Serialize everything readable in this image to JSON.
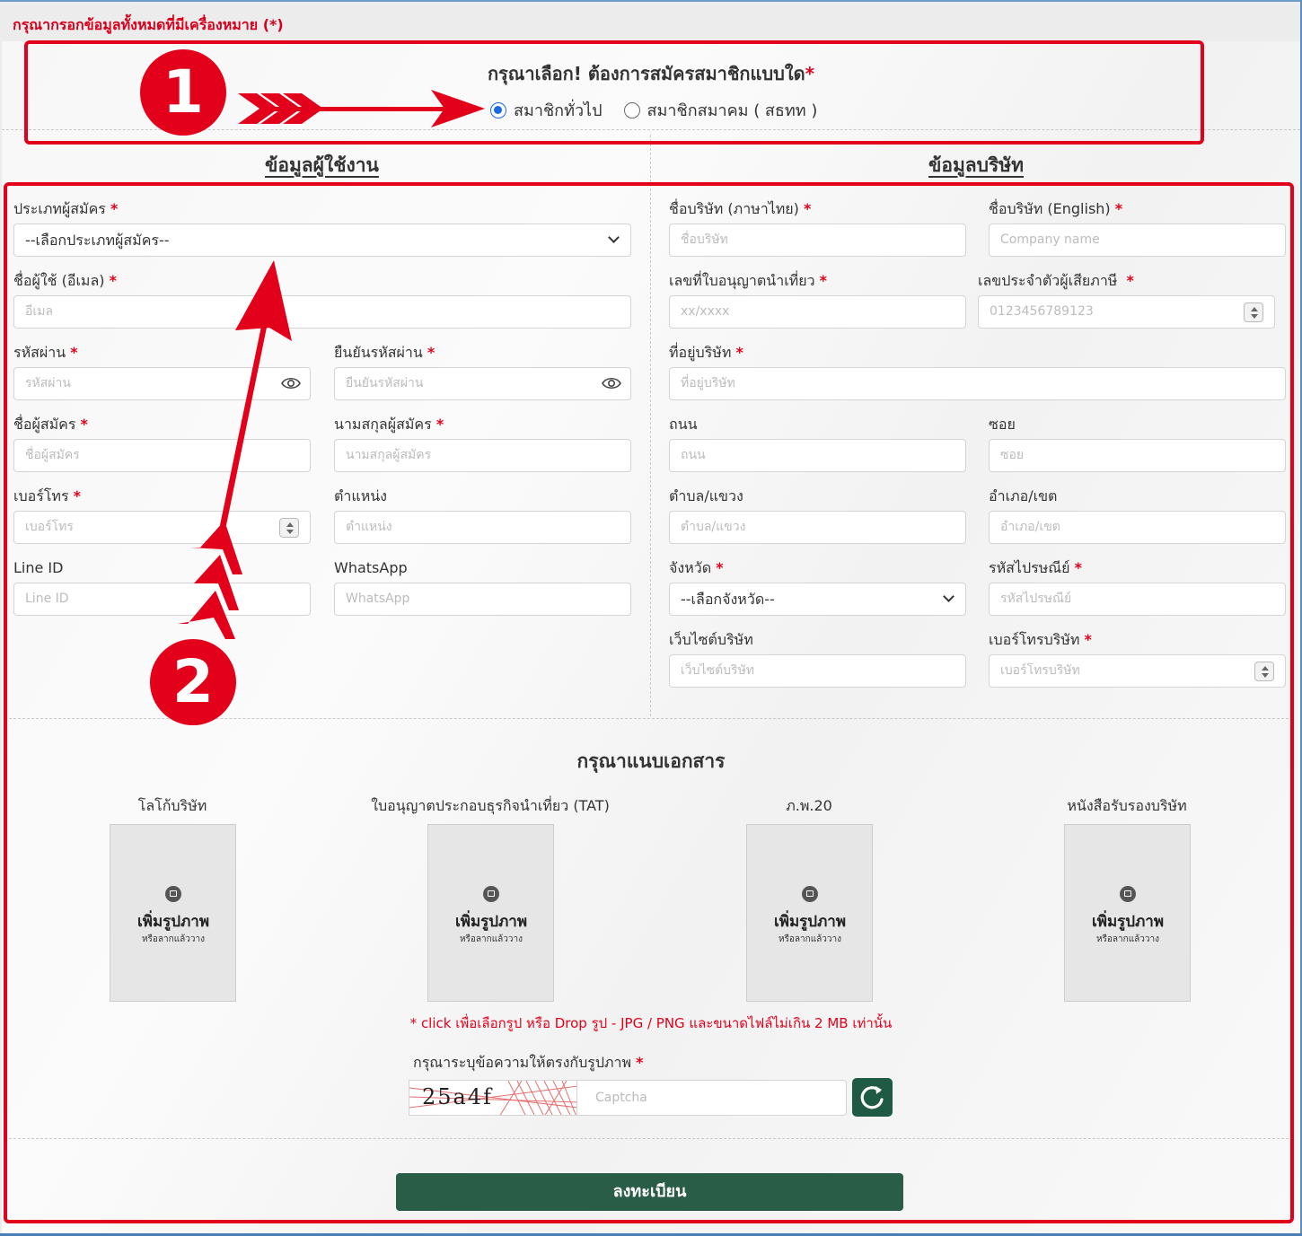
{
  "notice": "กรุณากรอกข้อมูลทั้งหมดที่มีเครื่องหมาย (*)",
  "membership": {
    "title": "กรุณาเลือก! ต้องการสมัครสมาชิกแบบใด",
    "options": [
      "สมาชิกทั่วไป",
      "สมาชิกสมาคม ( สธทท )"
    ],
    "selected": "สมาชิกทั่วไป"
  },
  "sections": {
    "user": "ข้อมูลผู้ใช้งาน",
    "company": "ข้อมูลบริษัท"
  },
  "user": {
    "applicant_type": {
      "label": "ประเภทผู้สมัคร",
      "value": "--เลือกประเภทผู้สมัคร--"
    },
    "email": {
      "label": "ชื่อผู้ใช้ (อีเมล)",
      "placeholder": "อีเมล"
    },
    "password": {
      "label": "รหัสผ่าน",
      "placeholder": "รหัสผ่าน"
    },
    "confirm_password": {
      "label": "ยืนยันรหัสผ่าน",
      "placeholder": "ยืนยันรหัสผ่าน"
    },
    "first_name": {
      "label": "ชื่อผู้สมัคร",
      "placeholder": "ชื่อผู้สมัคร"
    },
    "last_name": {
      "label": "นามสกุลผู้สมัคร",
      "placeholder": "นามสกุลผู้สมัคร"
    },
    "phone": {
      "label": "เบอร์โทร",
      "placeholder": "เบอร์โทร"
    },
    "position": {
      "label": "ตำแหน่ง",
      "placeholder": "ตำแหน่ง"
    },
    "line": {
      "label": "Line ID",
      "placeholder": "Line ID"
    },
    "whatsapp": {
      "label": "WhatsApp",
      "placeholder": "WhatsApp"
    }
  },
  "company": {
    "name_th": {
      "label": "ชื่อบริษัท (ภาษาไทย)",
      "placeholder": "ชื่อบริษัท"
    },
    "name_en": {
      "label": "ชื่อบริษัท (English)",
      "placeholder": "Company name"
    },
    "license_no": {
      "label": "เลขที่ใบอนุญาตนำเที่ยว",
      "placeholder": "xx/xxxx"
    },
    "tax_id": {
      "label": "เลขประจำตัวผู้เสียภาษี",
      "placeholder": "0123456789123"
    },
    "address": {
      "label": "ที่อยู่บริษัท",
      "placeholder": "ที่อยู่บริษัท"
    },
    "road": {
      "label": "ถนน",
      "placeholder": "ถนน"
    },
    "soi": {
      "label": "ซอย",
      "placeholder": "ซอย"
    },
    "subdistrict": {
      "label": "ตำบล/แขวง",
      "placeholder": "ตำบล/แขวง"
    },
    "district": {
      "label": "อำเภอ/เขต",
      "placeholder": "อำเภอ/เขต"
    },
    "province": {
      "label": "จังหวัด",
      "value": "--เลือกจังหวัด--"
    },
    "postcode": {
      "label": "รหัสไปรษณีย์",
      "placeholder": "รหัสไปรษณีย์"
    },
    "website": {
      "label": "เว็บไซต์บริษัท",
      "placeholder": "เว็บไซต์บริษัท"
    },
    "company_phone": {
      "label": "เบอร์โทรบริษัท",
      "placeholder": "เบอร์โทรบริษัท"
    }
  },
  "documents": {
    "title": "กรุณาแนบเอกสาร",
    "items": [
      {
        "label": "โลโก้บริษัท"
      },
      {
        "label": "ใบอนุญาตประกอบธุรกิจนำเที่ยว (TAT)"
      },
      {
        "label": "ภ.พ.20"
      },
      {
        "label": "หนังสือรับรองบริษัท"
      }
    ],
    "add_text": "เพิ่มรูปภาพ",
    "drag_text": "หรือลากแล้ววาง",
    "note": "* click เพื่อเลือกรูป หรือ Drop รูป - JPG / PNG และขนาดไฟล์ไม่เกิน 2 MB เท่านั้น"
  },
  "captcha": {
    "label": "กรุณาระบุข้อความให้ตรงกับรูปภาพ",
    "code": "25a4f",
    "placeholder": "Captcha"
  },
  "submit_label": "ลงทะเบียน",
  "badges": [
    "1",
    "2"
  ],
  "required_mark": "*"
}
